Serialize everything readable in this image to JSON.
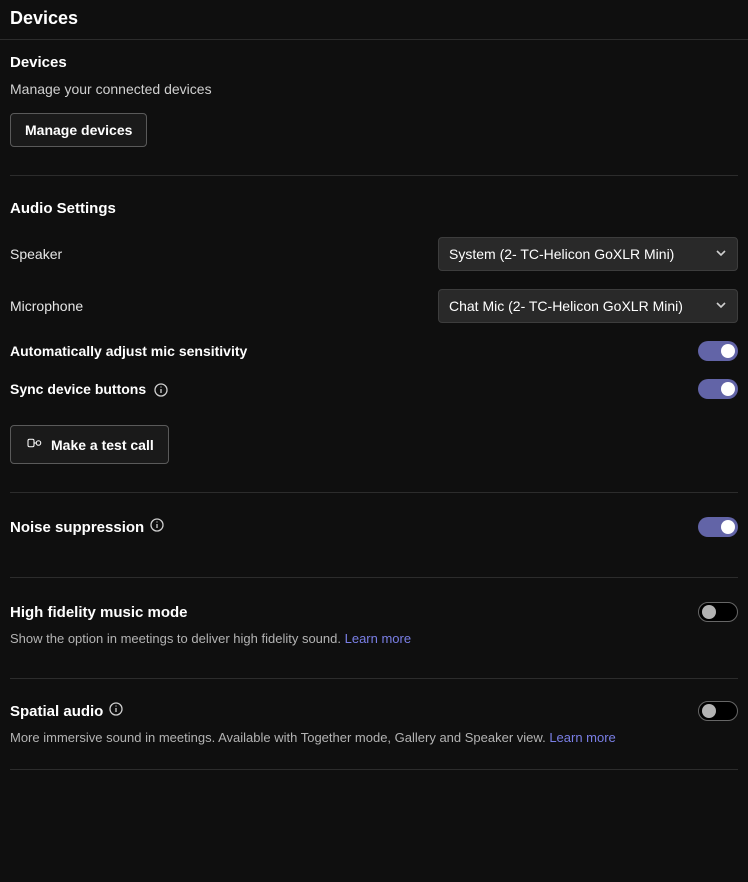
{
  "title": "Devices",
  "devices": {
    "heading": "Devices",
    "subtitle": "Manage your connected devices",
    "manage_button": "Manage devices"
  },
  "audio": {
    "heading": "Audio Settings",
    "speaker_label": "Speaker",
    "speaker_value": "System (2- TC-Helicon GoXLR Mini)",
    "microphone_label": "Microphone",
    "microphone_value": "Chat Mic (2- TC-Helicon GoXLR Mini)",
    "auto_adjust_label": "Automatically adjust mic sensitivity",
    "auto_adjust_on": true,
    "sync_buttons_label": "Sync device buttons",
    "sync_buttons_on": true,
    "test_call_button": "Make a test call"
  },
  "noise": {
    "title": "Noise suppression",
    "on": true
  },
  "hifi": {
    "title": "High fidelity music mode",
    "desc": "Show the option in meetings to deliver high fidelity sound.",
    "learn_more": "Learn more",
    "on": false
  },
  "spatial": {
    "title": "Spatial audio",
    "desc": "More immersive sound in meetings. Available with Together mode, Gallery and Speaker view.",
    "learn_more": "Learn more",
    "on": false
  }
}
